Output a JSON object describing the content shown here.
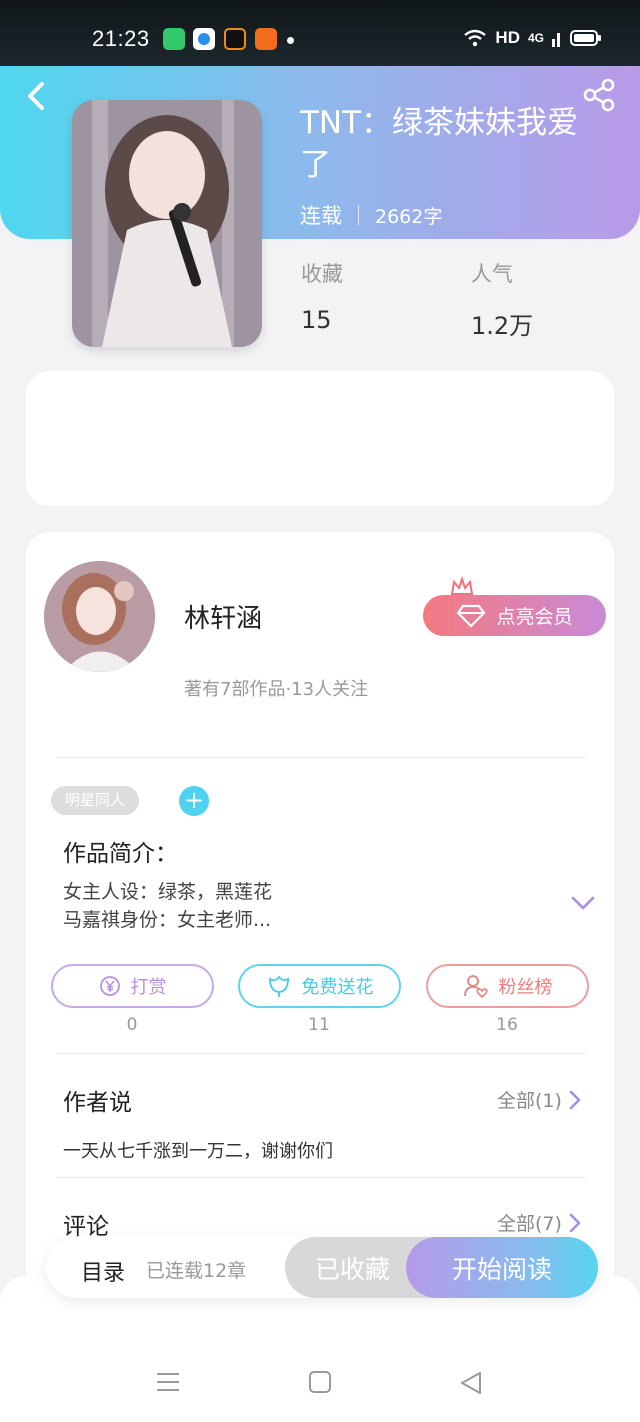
{
  "status_bar": {
    "time": "21:23",
    "network": "HD",
    "signal": "4G"
  },
  "book": {
    "title": "TNT：绿茶妹妹我爱了",
    "status": "连载",
    "words": "2662字",
    "stats": [
      {
        "label": "收藏",
        "value": "15"
      },
      {
        "label": "人气",
        "value": "1.2万"
      }
    ]
  },
  "author": {
    "name": "林轩涵",
    "summary": "著有7部作品·13人关注",
    "vip_label": "点亮会员"
  },
  "tags": {
    "items": [
      "明星同人"
    ],
    "add": "+"
  },
  "intro": {
    "heading": "作品简介：",
    "line1": "女主人设：绿茶，黑莲花",
    "line2": "马嘉祺身份：女主老师..."
  },
  "actions": [
    {
      "label": "打赏",
      "count": "0",
      "color": "#b78fe0"
    },
    {
      "label": "免费送花",
      "count": "11",
      "color": "#41cde6"
    },
    {
      "label": "粉丝榜",
      "count": "16",
      "color": "#ec7f82"
    }
  ],
  "author_says": {
    "heading": "作者说",
    "all": "全部(1)",
    "text": "一天从七千涨到一万二，谢谢你们"
  },
  "comments": {
    "heading": "评论",
    "all": "全部(7)"
  },
  "bottom_bar": {
    "toc": "目录",
    "toc_sub": "已连载12章",
    "collected": "已收藏",
    "read": "开始阅读"
  }
}
